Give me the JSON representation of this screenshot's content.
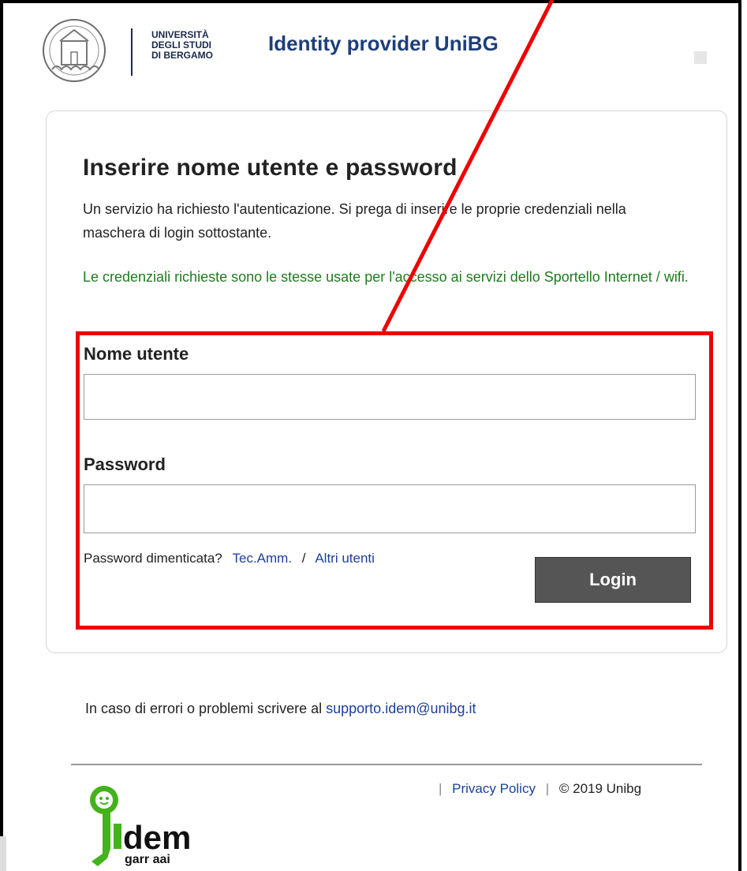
{
  "header": {
    "university_lines": [
      "UNIVERSITÀ",
      "DEGLI STUDI",
      "DI BERGAMO"
    ],
    "title": "Identity provider UniBG"
  },
  "card": {
    "heading": "Inserire nome utente e password",
    "description": "Un servizio ha richiesto l'autenticazione. Si prega di inserire le proprie credenziali nella maschera di login sottostante.",
    "note": "Le credenziali richieste sono le stesse usate per l'accesso ai servizi dello Sportello Internet / wifi.",
    "username_label": "Nome utente",
    "username_value": "",
    "password_label": "Password",
    "password_value": "",
    "forgot_text": "Password dimenticata?",
    "forgot_link_1": "Tec.Amm.",
    "forgot_separator": "/",
    "forgot_link_2": "Altri utenti",
    "login_label": "Login"
  },
  "support": {
    "text": "In caso di errori o problemi scrivere al",
    "email": "supporto.idem@unibg.it"
  },
  "footer": {
    "privacy": "Privacy Policy",
    "copyright": "© 2019 Unibg",
    "idem_word": "idem",
    "idem_sub": "garr aai"
  },
  "colors": {
    "accent_title": "#1d3f7a",
    "link": "#1d3f9a",
    "note_green": "#1f7a1f",
    "highlight_red": "#ee0000",
    "button_bg": "#555555",
    "idem_green": "#44b21c"
  }
}
